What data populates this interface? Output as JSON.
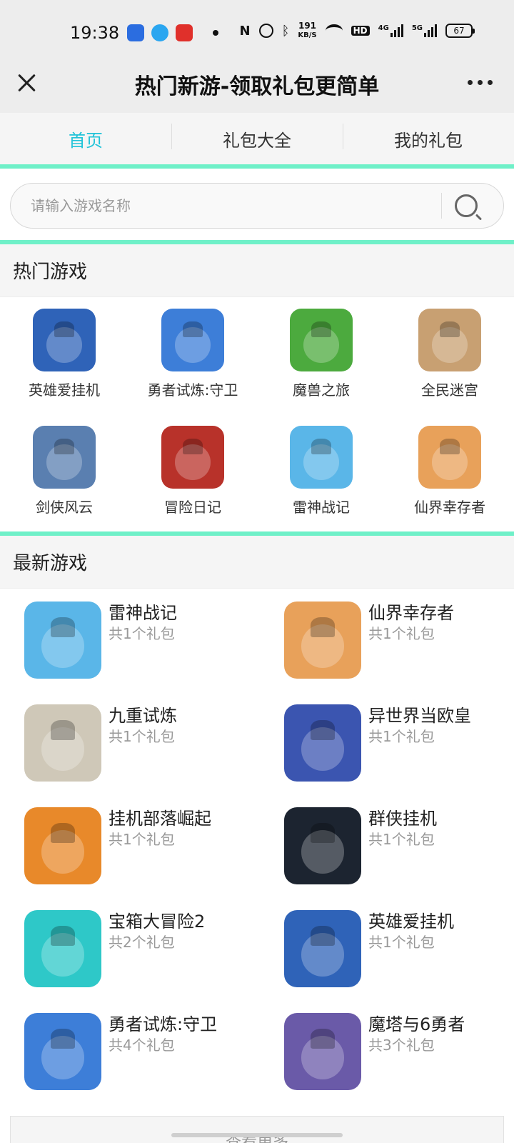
{
  "status": {
    "time": "19:38",
    "net_speed_top": "191",
    "net_speed_bottom": "KB/S",
    "net_hd": "HD",
    "sig1": "4G",
    "sig2": "5G",
    "battery": "67"
  },
  "titlebar": {
    "title": "热门新游-领取礼包更简单"
  },
  "tabs": [
    {
      "label": "首页"
    },
    {
      "label": "礼包大全"
    },
    {
      "label": "我的礼包"
    }
  ],
  "search": {
    "placeholder": "请输入游戏名称"
  },
  "hot": {
    "title": "热门游戏",
    "items": [
      {
        "label": "英雄爱挂机",
        "color": "#2f63b8",
        "icon": "horned-hero-icon"
      },
      {
        "label": "勇者试炼:守卫",
        "color": "#3d7ed8",
        "icon": "purple-slime-icon"
      },
      {
        "label": "魔兽之旅",
        "color": "#4caa3e",
        "icon": "gunner-icon"
      },
      {
        "label": "全民迷宫",
        "color": "#c8a072",
        "icon": "adventurer-icon"
      },
      {
        "label": "剑侠风云",
        "color": "#5a7fb0",
        "icon": "swordsman-icon"
      },
      {
        "label": "冒险日记",
        "color": "#b8322a",
        "icon": "dragon-icon"
      },
      {
        "label": "雷神战记",
        "color": "#5ab6e8",
        "icon": "witch-icon"
      },
      {
        "label": "仙界幸存者",
        "color": "#e8a15a",
        "icon": "fairy-icon"
      }
    ]
  },
  "latest": {
    "title": "最新游戏",
    "items": [
      {
        "name": "雷神战记",
        "count": "共1个礼包",
        "color": "#5ab6e8",
        "icon": "witch-icon"
      },
      {
        "name": "仙界幸存者",
        "count": "共1个礼包",
        "color": "#e8a15a",
        "icon": "fairy-icon"
      },
      {
        "name": "九重试炼",
        "count": "共1个礼包",
        "color": "#cfc8b8",
        "icon": "sage-icon"
      },
      {
        "name": "异世界当欧皇",
        "count": "共1个礼包",
        "color": "#3b55b0",
        "icon": "king-icon"
      },
      {
        "name": "挂机部落崛起",
        "count": "共1个礼包",
        "color": "#e8892a",
        "icon": "orc-icon"
      },
      {
        "name": "群侠挂机",
        "count": "共1个礼包",
        "color": "#1c2430",
        "icon": "moon-warrior-icon"
      },
      {
        "name": "宝箱大冒险2",
        "count": "共2个礼包",
        "color": "#2ec8c8",
        "icon": "dragon-icon"
      },
      {
        "name": "英雄爱挂机",
        "count": "共1个礼包",
        "color": "#2f63b8",
        "icon": "horned-hero-icon"
      },
      {
        "name": "勇者试炼:守卫",
        "count": "共4个礼包",
        "color": "#3d7ed8",
        "icon": "purple-slime-icon"
      },
      {
        "name": "魔塔与6勇者",
        "count": "共3个礼包",
        "color": "#6a5aa8",
        "icon": "sword-icon"
      }
    ]
  },
  "more_button": "查看更多"
}
